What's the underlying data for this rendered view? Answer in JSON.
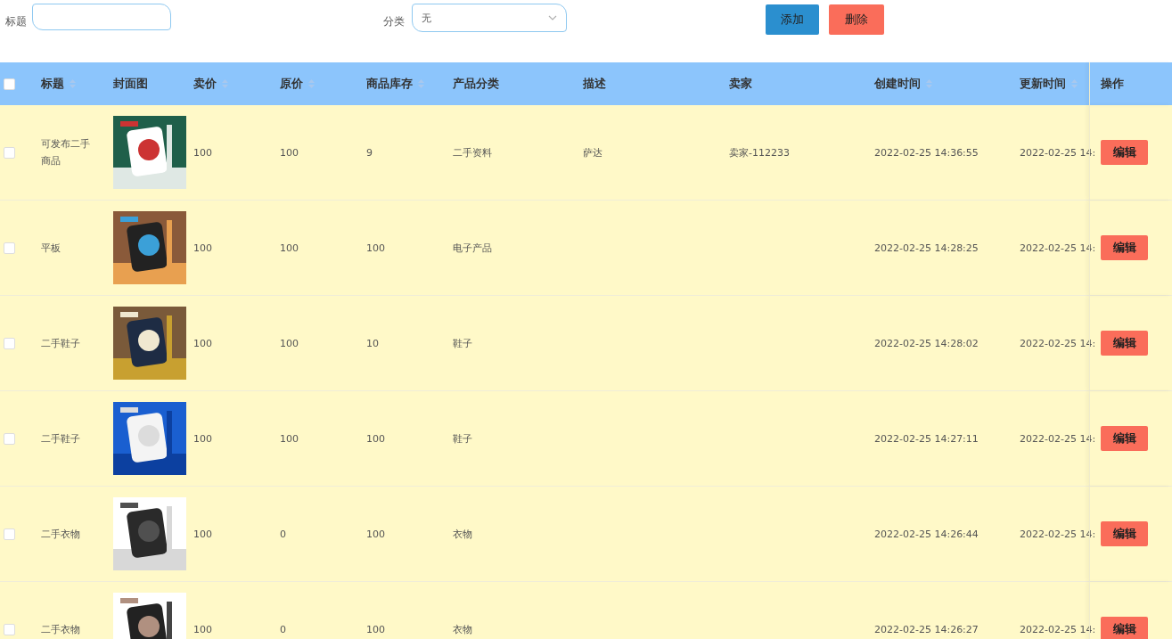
{
  "filters": {
    "title_label": "标题",
    "category_label": "分类",
    "category_value": "无"
  },
  "buttons": {
    "add": "添加",
    "delete": "删除"
  },
  "table": {
    "select_all": {
      "checked": false
    },
    "columns": [
      {
        "label": "标题",
        "sortable": true
      },
      {
        "label": "封面图",
        "sortable": false
      },
      {
        "label": "卖价",
        "sortable": true
      },
      {
        "label": "原价",
        "sortable": true
      },
      {
        "label": "商品库存",
        "sortable": true
      },
      {
        "label": "产品分类",
        "sortable": false
      },
      {
        "label": "描述",
        "sortable": false
      },
      {
        "label": "卖家",
        "sortable": false
      },
      {
        "label": "创建时间",
        "sortable": true
      },
      {
        "label": "更新时间",
        "sortable": true
      },
      {
        "label": "操作",
        "sortable": false
      }
    ],
    "rows": [
      {
        "checked": false,
        "title": "可发布二手商品",
        "price": "100",
        "original_price": "100",
        "stock": "9",
        "category": "二手资料",
        "description": "萨达",
        "seller": "卖家-112233",
        "created": "2022-02-25 14:36:55",
        "updated": "2022-02-25 14:",
        "action": "编辑"
      },
      {
        "checked": false,
        "title": "平板",
        "price": "100",
        "original_price": "100",
        "stock": "100",
        "category": "电子产品",
        "created": "2022-02-25 14:28:25",
        "updated": "2022-02-25 14:",
        "action": "编辑"
      },
      {
        "checked": false,
        "title": "二手鞋子",
        "price": "100",
        "original_price": "100",
        "stock": "10",
        "category": "鞋子",
        "created": "2022-02-25 14:28:02",
        "updated": "2022-02-25 14:",
        "action": "编辑"
      },
      {
        "checked": false,
        "title": "二手鞋子",
        "price": "100",
        "original_price": "100",
        "stock": "100",
        "category": "鞋子",
        "created": "2022-02-25 14:27:11",
        "updated": "2022-02-25 14:",
        "action": "编辑"
      },
      {
        "checked": false,
        "title": "二手衣物",
        "price": "100",
        "original_price": "0",
        "stock": "100",
        "category": "衣物",
        "created": "2022-02-25 14:26:44",
        "updated": "2022-02-25 14:",
        "action": "编辑"
      },
      {
        "checked": false,
        "title": "二手衣物",
        "price": "100",
        "original_price": "0",
        "stock": "100",
        "category": "衣物",
        "created": "2022-02-25 14:26:27",
        "updated": "2022-02-25 14:",
        "action": "编辑"
      }
    ]
  }
}
